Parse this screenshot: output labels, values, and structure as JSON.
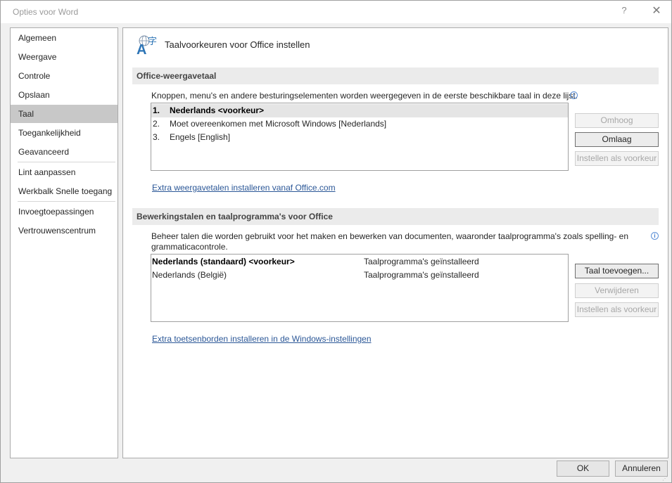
{
  "window": {
    "title": "Opties voor Word",
    "help_glyph": "?",
    "close_glyph": "✕"
  },
  "nav": {
    "items": [
      {
        "label": "Algemeen"
      },
      {
        "label": "Weergave"
      },
      {
        "label": "Controle"
      },
      {
        "label": "Opslaan"
      },
      {
        "label": "Taal",
        "selected": true
      },
      {
        "label": "Toegankelijkheid"
      },
      {
        "label": "Geavanceerd"
      },
      {
        "label": "Lint aanpassen"
      },
      {
        "label": "Werkbalk Snelle toegang"
      },
      {
        "label": "Invoegtoepassingen"
      },
      {
        "label": "Vertrouwenscentrum"
      }
    ]
  },
  "header": {
    "title": "Taalvoorkeuren voor Office instellen",
    "icon": "language-icon",
    "icon_glyph": "字",
    "icon_letter": "A"
  },
  "display": {
    "section_title": "Office-weergavetaal",
    "description": "Knoppen, menu's en andere besturingselementen worden weergegeven in de eerste beschikbare taal in deze lijst.",
    "info_glyph": "i",
    "languages": [
      {
        "num": "1.",
        "label": "Nederlands <voorkeur>",
        "selected": true
      },
      {
        "num": "2.",
        "label": "Moet overeenkomen met Microsoft Windows [Nederlands]"
      },
      {
        "num": "3.",
        "label": "Engels [English]"
      }
    ],
    "buttons": {
      "up": "Omhoog",
      "down": "Omlaag",
      "set_preferred": "Instellen als voorkeur"
    },
    "link": "Extra weergavetalen installeren vanaf Office.com"
  },
  "authoring": {
    "section_title": "Bewerkingstalen en taalprogramma's voor Office",
    "description_line1": "Beheer talen die worden gebruikt voor het maken en bewerken van documenten, waaronder taalprogramma's zoals spelling- en",
    "description_line2": "grammaticacontrole.",
    "info_glyph": "i",
    "languages": [
      {
        "label": "Nederlands (standaard) <voorkeur>",
        "status": "Taalprogramma's geïnstalleerd",
        "bold": true
      },
      {
        "label": "Nederlands (België)",
        "status": "Taalprogramma's geïnstalleerd"
      }
    ],
    "buttons": {
      "add": "Taal toevoegen...",
      "remove": "Verwijderen",
      "set_preferred": "Instellen als voorkeur"
    },
    "link": "Extra toetsenborden installeren in de Windows-instellingen"
  },
  "footer": {
    "ok": "OK",
    "cancel": "Annuleren"
  }
}
